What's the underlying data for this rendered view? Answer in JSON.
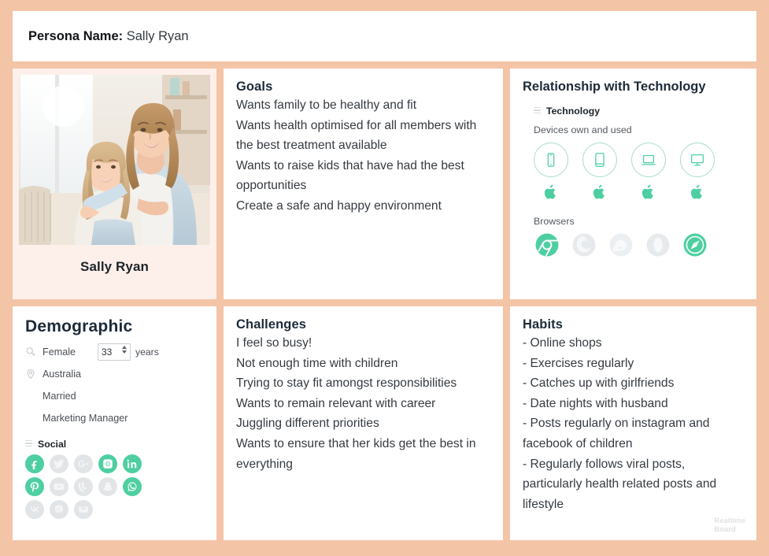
{
  "board": {
    "background_color": "#f4c4a6",
    "accent_color": "#4ecfa1",
    "card_color": "#ffffff",
    "photo_card_color": "#fdf0ea"
  },
  "header": {
    "label": "Persona Name:",
    "value": " Sally Ryan"
  },
  "photo": {
    "caption": "Sally Ryan",
    "alt": "Mother and daughter sitting on a sofa smiling"
  },
  "goals": {
    "title": "Goals",
    "lines": [
      "Wants family to be healthy and fit",
      "Wants health optimised for all members with the best treatment available",
      "Wants to raise kids that have had the best opportunities",
      "Create a safe and happy environment"
    ]
  },
  "technology": {
    "title": "Relationship with Technology",
    "section_label": "Technology",
    "devices_label": "Devices own and used",
    "devices": [
      {
        "name": "smartphone",
        "os": "apple"
      },
      {
        "name": "tablet",
        "os": "apple"
      },
      {
        "name": "laptop",
        "os": "apple"
      },
      {
        "name": "desktop",
        "os": "apple"
      }
    ],
    "browsers_label": "Browsers",
    "browsers": [
      {
        "name": "chrome",
        "active": true
      },
      {
        "name": "firefox",
        "active": false
      },
      {
        "name": "internet-explorer",
        "active": false
      },
      {
        "name": "opera",
        "active": false
      },
      {
        "name": "safari",
        "active": true
      }
    ]
  },
  "demographic": {
    "title": "Demographic",
    "gender": "Female",
    "age_value": "33",
    "age_unit": "years",
    "location": "Australia",
    "marital_status": "Married",
    "occupation": "Marketing Manager",
    "social_label": "Social",
    "social": [
      [
        {
          "name": "facebook",
          "active": true
        },
        {
          "name": "twitter",
          "active": false
        },
        {
          "name": "google-plus",
          "active": false
        },
        {
          "name": "instagram",
          "active": true
        },
        {
          "name": "linkedin",
          "active": true
        }
      ],
      [
        {
          "name": "pinterest",
          "active": true
        },
        {
          "name": "youtube",
          "active": false
        },
        {
          "name": "vine",
          "active": false
        },
        {
          "name": "snapchat",
          "active": false
        },
        {
          "name": "whatsapp",
          "active": true
        }
      ],
      [
        {
          "name": "vk",
          "active": false
        },
        {
          "name": "viber",
          "active": false
        },
        {
          "name": "email",
          "active": false
        }
      ]
    ]
  },
  "challenges": {
    "title": "Challenges",
    "lines": [
      "I feel so busy!",
      "Not enough time with children",
      "Trying to stay fit amongst responsibilities",
      "Wants to remain relevant with career",
      "Juggling different priorities",
      "Wants to ensure that her kids get the best in everything"
    ]
  },
  "habits": {
    "title": "Habits",
    "lines": [
      "- Online shops",
      "- Exercises regularly",
      "- Catches up with girlfriends",
      "- Date nights with husband",
      "- Posts regularly on instagram and facebook of children",
      "- Regularly follows viral posts, particularly health related posts and lifestyle"
    ]
  },
  "watermark": {
    "line1": "Realtime",
    "line2": "Board"
  }
}
